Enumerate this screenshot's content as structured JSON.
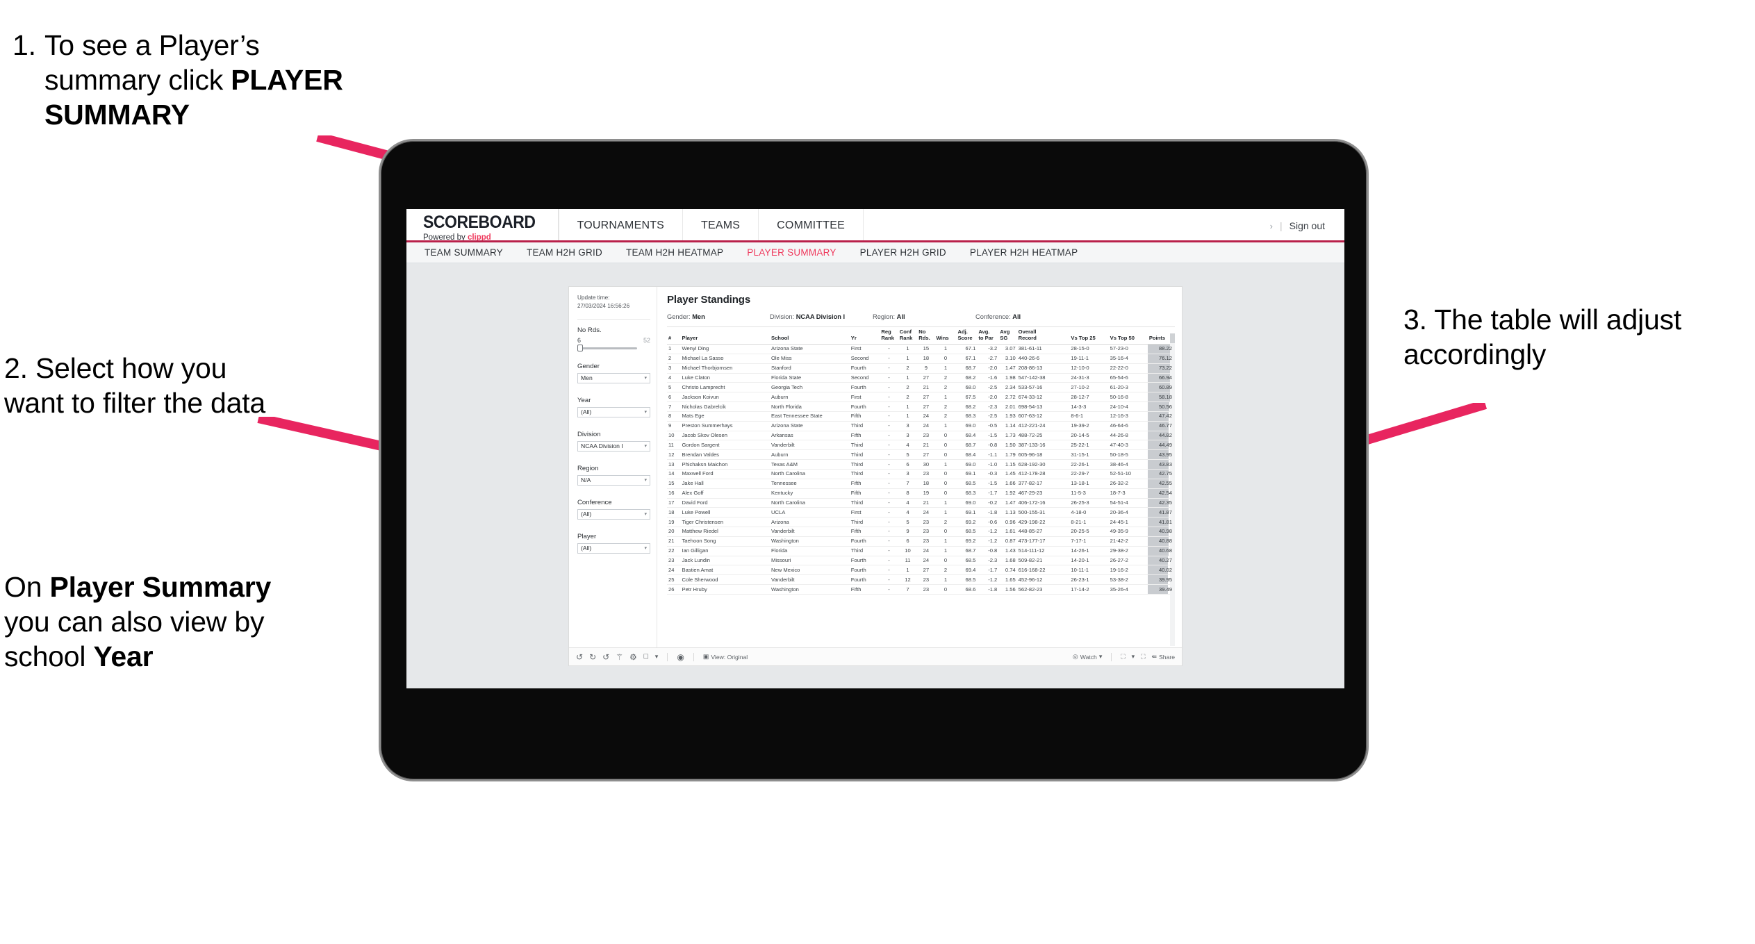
{
  "annotations": {
    "step1": {
      "number": "1.",
      "line1": "To see a Player’s",
      "line2pre": "summary click ",
      "line2bold": "PLAYER",
      "line3bold": "SUMMARY"
    },
    "step2": {
      "text": "2. Select how you want to filter the data"
    },
    "step2b": {
      "pre": "On ",
      "bold1": "Player Summary",
      "mid": " you can also view by school ",
      "bold2": "Year"
    },
    "step3": {
      "text": "3. The table will adjust accordingly"
    }
  },
  "app": {
    "brand": {
      "logo": "SCOREBOARD",
      "powered_pre": "Powered by ",
      "powered_brand": "clippd"
    },
    "topnav": [
      "TOURNAMENTS",
      "TEAMS",
      "COMMITTEE"
    ],
    "header_right": {
      "chevron": "›",
      "separator": "|",
      "signout": "Sign out"
    },
    "subtabs": [
      {
        "label": "TEAM SUMMARY",
        "active": false
      },
      {
        "label": "TEAM H2H GRID",
        "active": false
      },
      {
        "label": "TEAM H2H HEATMAP",
        "active": false
      },
      {
        "label": "PLAYER SUMMARY",
        "active": true
      },
      {
        "label": "PLAYER H2H GRID",
        "active": false
      },
      {
        "label": "PLAYER H2H HEATMAP",
        "active": false
      }
    ],
    "accent_color": "#ef3a5d",
    "underline_color": "#b9204a"
  },
  "viz": {
    "update_label": "Update time:",
    "update_value": "27/03/2024 16:56:26",
    "title": "Player Standings",
    "meta": [
      {
        "label": "Gender:",
        "value": "Men"
      },
      {
        "label": "Division:",
        "value": "NCAA Division I"
      },
      {
        "label": "Region:",
        "value": "All"
      },
      {
        "label": "Conference:",
        "value": "All"
      }
    ],
    "filters": {
      "no_rds": {
        "label": "No Rds.",
        "min": "6",
        "max": "52"
      },
      "gender": {
        "label": "Gender",
        "value": "Men"
      },
      "year": {
        "label": "Year",
        "value": "(All)"
      },
      "division": {
        "label": "Division",
        "value": "NCAA Division I"
      },
      "region": {
        "label": "Region",
        "value": "N/A"
      },
      "conference": {
        "label": "Conference",
        "value": "(All)"
      },
      "player": {
        "label": "Player",
        "value": "(All)"
      },
      "caret": "▾"
    },
    "toolbar": {
      "undo": "↺",
      "redo": "↻",
      "revert": "↺",
      "view_label": "View: Original",
      "watch_label": "Watch",
      "share_label": "Share",
      "caret": "▾"
    }
  },
  "table": {
    "columns": [
      {
        "key": "rank",
        "l1": "#",
        "l2": ""
      },
      {
        "key": "player",
        "l1": "Player",
        "l2": ""
      },
      {
        "key": "school",
        "l1": "School",
        "l2": ""
      },
      {
        "key": "yr",
        "l1": "Yr",
        "l2": ""
      },
      {
        "key": "reg",
        "l1": "Reg",
        "l2": "Rank"
      },
      {
        "key": "conf",
        "l1": "Conf",
        "l2": "Rank"
      },
      {
        "key": "nords",
        "l1": "No",
        "l2": "Rds."
      },
      {
        "key": "wins",
        "l1": "",
        "l2": "Wins"
      },
      {
        "key": "adj",
        "l1": "Adj.",
        "l2": "Score"
      },
      {
        "key": "avgp",
        "l1": "Avg.",
        "l2": "to Par"
      },
      {
        "key": "avgsg",
        "l1": "Avg",
        "l2": "SG"
      },
      {
        "key": "rec",
        "l1": "Overall",
        "l2": "Record"
      },
      {
        "key": "t25",
        "l1": "",
        "l2": "Vs Top 25"
      },
      {
        "key": "t50",
        "l1": "",
        "l2": "Vs Top 50"
      },
      {
        "key": "pts",
        "l1": "",
        "l2": "Points"
      }
    ],
    "rows": [
      [
        "1",
        "Wenyi Ding",
        "Arizona State",
        "First",
        "-",
        "1",
        "15",
        "1",
        "67.1",
        "-3.2",
        "3.07",
        "381-61-11",
        "28-15-0",
        "57-23-0",
        "88.22"
      ],
      [
        "2",
        "Michael La Sasso",
        "Ole Miss",
        "Second",
        "-",
        "1",
        "18",
        "0",
        "67.1",
        "-2.7",
        "3.10",
        "440-26-6",
        "19-11-1",
        "35-16-4",
        "76.12"
      ],
      [
        "3",
        "Michael Thorbjornsen",
        "Stanford",
        "Fourth",
        "-",
        "2",
        "9",
        "1",
        "68.7",
        "-2.0",
        "1.47",
        "208-86-13",
        "12-10-0",
        "22-22-0",
        "73.22"
      ],
      [
        "4",
        "Luke Claton",
        "Florida State",
        "Second",
        "-",
        "1",
        "27",
        "2",
        "68.2",
        "-1.6",
        "1.98",
        "547-142-38",
        "24-31-3",
        "65-54-6",
        "66.94"
      ],
      [
        "5",
        "Christo Lamprecht",
        "Georgia Tech",
        "Fourth",
        "-",
        "2",
        "21",
        "2",
        "68.0",
        "-2.5",
        "2.34",
        "533-57-16",
        "27-10-2",
        "61-20-3",
        "60.89"
      ],
      [
        "6",
        "Jackson Koivun",
        "Auburn",
        "First",
        "-",
        "2",
        "27",
        "1",
        "67.5",
        "-2.0",
        "2.72",
        "674-33-12",
        "28-12-7",
        "50-16-8",
        "58.18"
      ],
      [
        "7",
        "Nicholas Gabrelcik",
        "North Florida",
        "Fourth",
        "-",
        "1",
        "27",
        "2",
        "68.2",
        "-2.3",
        "2.01",
        "698-54-13",
        "14-3-3",
        "24-10-4",
        "50.56"
      ],
      [
        "8",
        "Mats Ege",
        "East Tennessee State",
        "Fifth",
        "-",
        "1",
        "24",
        "2",
        "68.3",
        "-2.5",
        "1.93",
        "607-63-12",
        "8-6-1",
        "12-16-3",
        "47.42"
      ],
      [
        "9",
        "Preston Summerhays",
        "Arizona State",
        "Third",
        "-",
        "3",
        "24",
        "1",
        "69.0",
        "-0.5",
        "1.14",
        "412-221-24",
        "19-39-2",
        "46-64-6",
        "46.77"
      ],
      [
        "10",
        "Jacob Skov Olesen",
        "Arkansas",
        "Fifth",
        "-",
        "3",
        "23",
        "0",
        "68.4",
        "-1.5",
        "1.73",
        "488-72-25",
        "20-14-5",
        "44-26-8",
        "44.82"
      ],
      [
        "11",
        "Gordon Sargent",
        "Vanderbilt",
        "Third",
        "-",
        "4",
        "21",
        "0",
        "68.7",
        "-0.8",
        "1.50",
        "387-133-16",
        "25-22-1",
        "47-40-3",
        "44.49"
      ],
      [
        "12",
        "Brendan Valdes",
        "Auburn",
        "Third",
        "-",
        "5",
        "27",
        "0",
        "68.4",
        "-1.1",
        "1.79",
        "605-96-18",
        "31-15-1",
        "50-18-5",
        "43.95"
      ],
      [
        "13",
        "Phichaksn Maichon",
        "Texas A&M",
        "Third",
        "-",
        "6",
        "30",
        "1",
        "69.0",
        "-1.0",
        "1.15",
        "628-192-30",
        "22-26-1",
        "38-46-4",
        "43.83"
      ],
      [
        "14",
        "Maxwell Ford",
        "North Carolina",
        "Third",
        "-",
        "3",
        "23",
        "0",
        "69.1",
        "-0.3",
        "1.45",
        "412-178-28",
        "22-29-7",
        "52-51-10",
        "42.75"
      ],
      [
        "15",
        "Jake Hall",
        "Tennessee",
        "Fifth",
        "-",
        "7",
        "18",
        "0",
        "68.5",
        "-1.5",
        "1.66",
        "377-82-17",
        "13-18-1",
        "26-32-2",
        "42.55"
      ],
      [
        "16",
        "Alex Goff",
        "Kentucky",
        "Fifth",
        "-",
        "8",
        "19",
        "0",
        "68.3",
        "-1.7",
        "1.92",
        "467-29-23",
        "11-5-3",
        "18-7-3",
        "42.54"
      ],
      [
        "17",
        "David Ford",
        "North Carolina",
        "Third",
        "-",
        "4",
        "21",
        "1",
        "69.0",
        "-0.2",
        "1.47",
        "406-172-16",
        "26-25-3",
        "54-51-4",
        "42.35"
      ],
      [
        "18",
        "Luke Powell",
        "UCLA",
        "First",
        "-",
        "4",
        "24",
        "1",
        "69.1",
        "-1.8",
        "1.13",
        "500-155-31",
        "4-18-0",
        "20-36-4",
        "41.87"
      ],
      [
        "19",
        "Tiger Christensen",
        "Arizona",
        "Third",
        "-",
        "5",
        "23",
        "2",
        "69.2",
        "-0.6",
        "0.96",
        "429-198-22",
        "8-21-1",
        "24-45-1",
        "41.81"
      ],
      [
        "20",
        "Matthew Riedel",
        "Vanderbilt",
        "Fifth",
        "-",
        "9",
        "23",
        "0",
        "68.5",
        "-1.2",
        "1.61",
        "448-85-27",
        "20-25-5",
        "49-35-9",
        "40.98"
      ],
      [
        "21",
        "Taehoon Song",
        "Washington",
        "Fourth",
        "-",
        "6",
        "23",
        "1",
        "69.2",
        "-1.2",
        "0.87",
        "473-177-17",
        "7-17-1",
        "21-42-2",
        "40.88"
      ],
      [
        "22",
        "Ian Gilligan",
        "Florida",
        "Third",
        "-",
        "10",
        "24",
        "1",
        "68.7",
        "-0.8",
        "1.43",
        "514-111-12",
        "14-26-1",
        "29-38-2",
        "40.68"
      ],
      [
        "23",
        "Jack Lundin",
        "Missouri",
        "Fourth",
        "-",
        "11",
        "24",
        "0",
        "68.5",
        "-2.3",
        "1.68",
        "509-82-21",
        "14-20-1",
        "26-27-2",
        "40.27"
      ],
      [
        "24",
        "Bastien Amat",
        "New Mexico",
        "Fourth",
        "-",
        "1",
        "27",
        "2",
        "69.4",
        "-1.7",
        "0.74",
        "616-168-22",
        "10-11-1",
        "19-16-2",
        "40.02"
      ],
      [
        "25",
        "Cole Sherwood",
        "Vanderbilt",
        "Fourth",
        "-",
        "12",
        "23",
        "1",
        "68.5",
        "-1.2",
        "1.65",
        "452-96-12",
        "26-23-1",
        "53-38-2",
        "39.95"
      ],
      [
        "26",
        "Petr Hruby",
        "Washington",
        "Fifth",
        "-",
        "7",
        "23",
        "0",
        "68.6",
        "-1.8",
        "1.56",
        "562-82-23",
        "17-14-2",
        "35-26-4",
        "39.49"
      ]
    ],
    "points_max": 88.22
  }
}
